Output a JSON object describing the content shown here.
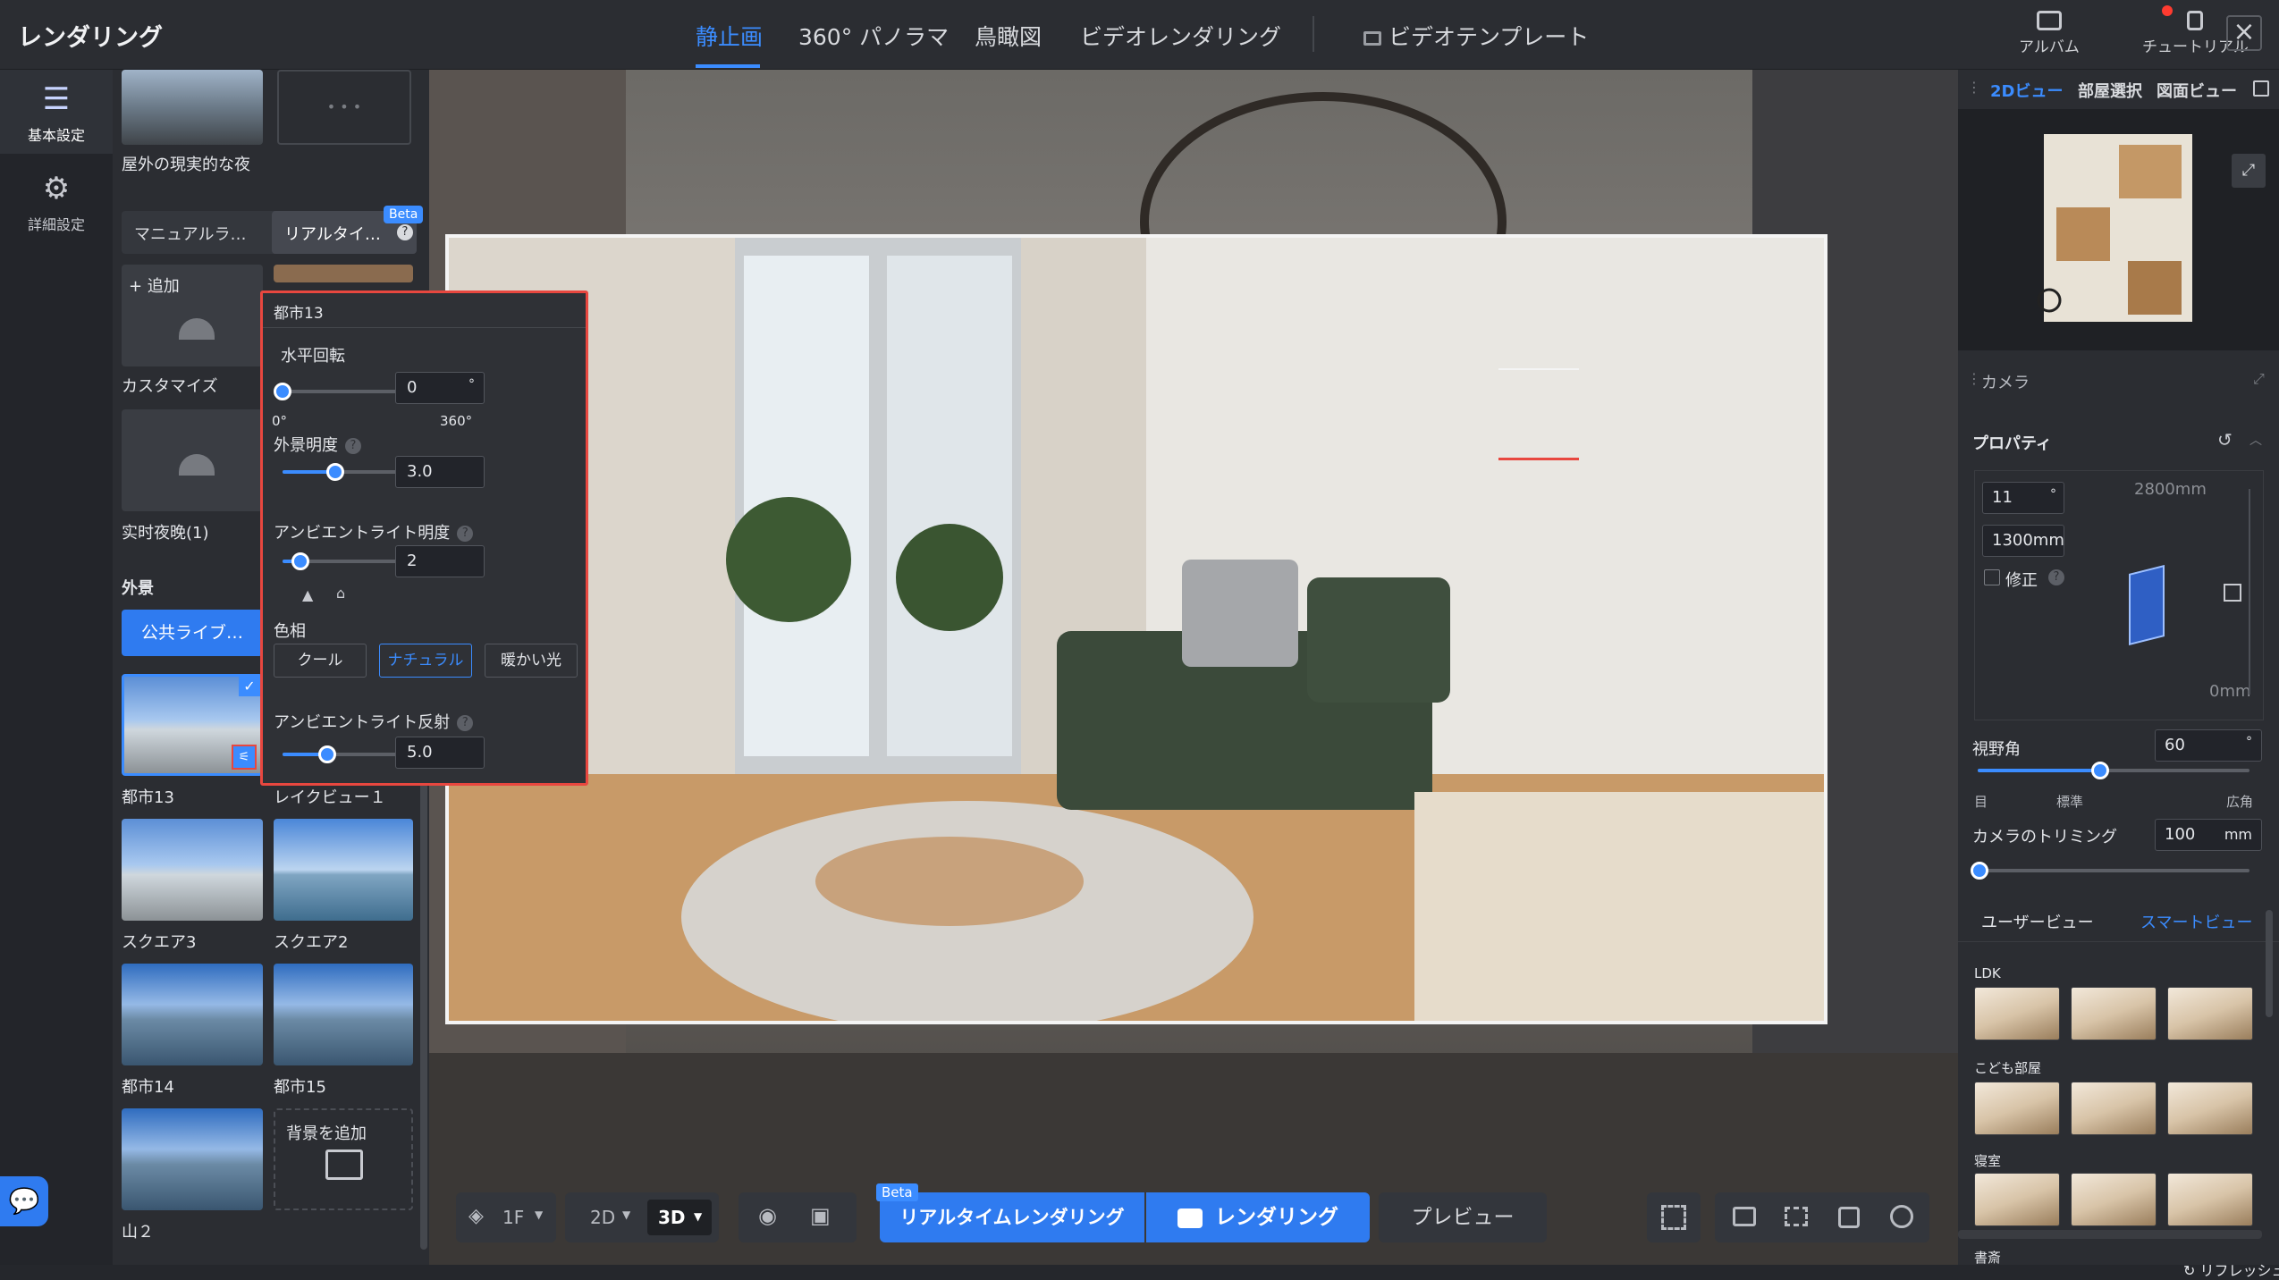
{
  "app": {
    "title": "レンダリング"
  },
  "top_tabs": [
    "静止画",
    "360° パノラマ",
    "鳥瞰図",
    "ビデオレンダリング"
  ],
  "video_template": "ビデオテンプレート",
  "top_right": {
    "album": "アルバム",
    "tutorial": "チュートリアル",
    "close": "×"
  },
  "left_nav": [
    {
      "label": "基本設定",
      "icon": "sliders-icon",
      "active": true
    },
    {
      "label": "詳細設定",
      "icon": "gear-icon",
      "active": false
    }
  ],
  "lighting": {
    "preset_label": "屋外の現実的な夜",
    "more": "• • •",
    "tabs": [
      "マニュアルラ…",
      "リアルタイ…"
    ],
    "beta": "Beta",
    "add": "+ 追加",
    "customize": "カスタマイズ",
    "realtime_night": "实时夜晚(1)"
  },
  "exterior": {
    "heading": "外景",
    "public_library": "公共ライブ…",
    "items": [
      "都市13",
      "レイクビュー１",
      "スクエア3",
      "スクエア2",
      "都市14",
      "都市15",
      "山２"
    ],
    "add_background": "背景を追加"
  },
  "popup": {
    "title": "都市13",
    "horizontal_rotation": {
      "label": "水平回転",
      "value": "0",
      "unit": "°",
      "min_label": "0°",
      "max_label": "360°",
      "fraction": 0.0
    },
    "exterior_brightness": {
      "label": "外景明度",
      "value": "3.0",
      "fraction": 0.3
    },
    "ambient_brightness": {
      "label": "アンビエントライト明度",
      "value": "2",
      "fraction": 0.1
    },
    "hue": {
      "label": "色相",
      "options": [
        "クール",
        "ナチュラル",
        "暖かい光"
      ],
      "selected": "ナチュラル"
    },
    "ambient_reflection": {
      "label": "アンビエントライト反射",
      "value": "5.0",
      "fraction": 0.25
    }
  },
  "bottom_toolbar": {
    "floor": "1F",
    "view_2d": "2D",
    "view_3d": "3D",
    "beta": "Beta",
    "realtime_render": "リアルタイムレンダリング",
    "render": "レンダリング",
    "preview": "プレビュー"
  },
  "right_panel": {
    "tabs": [
      "2Dビュー",
      "部屋選択",
      "図面ビュー"
    ],
    "camera_header": "カメラ",
    "properties": "プロパティ",
    "angle_value": "11",
    "angle_unit": "°",
    "height_value": "1300mm",
    "fix_label": "修正",
    "max_height": "2800mm",
    "min_height": "0mm",
    "fov_label": "視野角",
    "fov_value": "60",
    "fov_unit": "°",
    "fov_fraction": 0.45,
    "fov_ticks": [
      "目",
      "標準",
      "広角"
    ],
    "trim_label": "カメラのトリミング",
    "trim_value": "100",
    "trim_unit": "mm",
    "view_tabs": [
      "ユーザービュー",
      "スマートビュー"
    ],
    "groups": [
      "LDK",
      "こども部屋",
      "寝室",
      "書斎"
    ],
    "refresh": "リフレッシュ"
  },
  "colors": {
    "accent": "#3b8cff",
    "highlight_border": "#e8473f",
    "bg": "#2b2d32"
  }
}
